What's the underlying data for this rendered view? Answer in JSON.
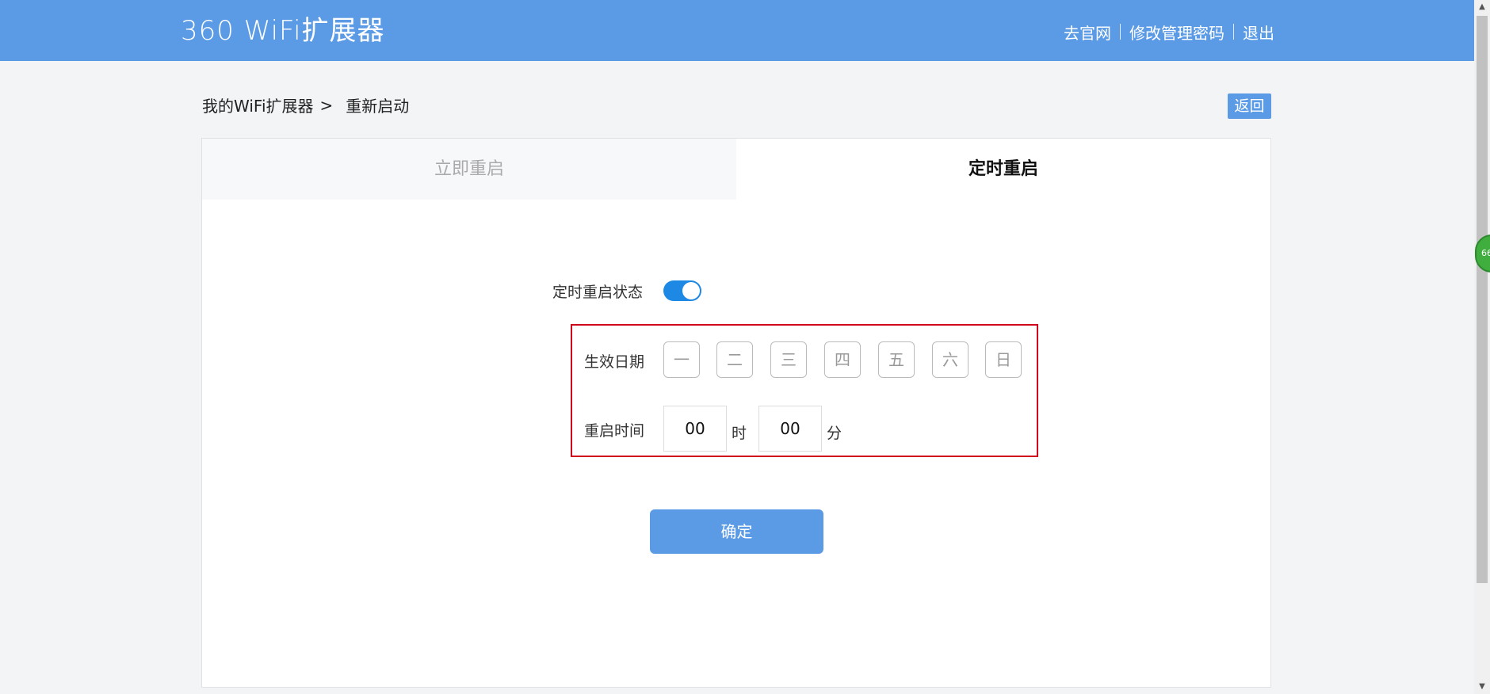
{
  "header": {
    "logo_text": "360 WiFi扩展器",
    "links": [
      "去官网",
      "修改管理密码",
      "退出"
    ]
  },
  "breadcrumb": {
    "root": "我的WiFi扩展器",
    "arrow": ">",
    "current": "重新启动"
  },
  "back_button": "返回",
  "tabs": [
    {
      "label": "立即重启",
      "active": false
    },
    {
      "label": "定时重启",
      "active": true
    }
  ],
  "schedule": {
    "status_label": "定时重启状态",
    "status_on": true,
    "days_label": "生效日期",
    "days": [
      "一",
      "二",
      "三",
      "四",
      "五",
      "六",
      "日"
    ],
    "time_label": "重启时间",
    "hour": "00",
    "hour_unit": "时",
    "minute": "00",
    "minute_unit": "分"
  },
  "confirm_button": "确定",
  "float_badge": "66",
  "colors": {
    "header_bg": "#5b9be6",
    "toggle_on": "#1e88e5",
    "highlight_border": "#d0021b",
    "button_bg": "#5b9be6"
  }
}
